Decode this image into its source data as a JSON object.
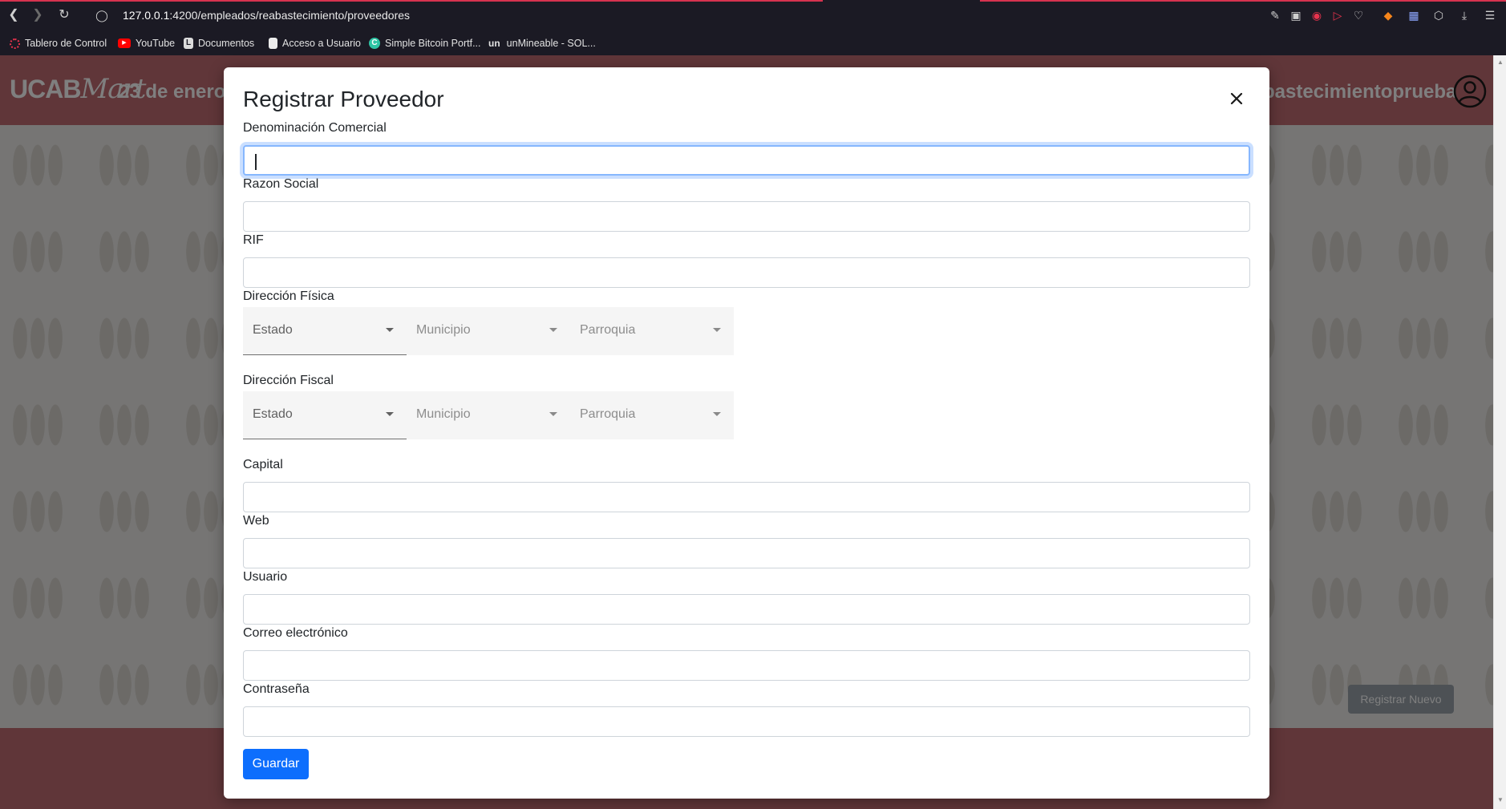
{
  "browser": {
    "url_host": "127.0.0.1",
    "url_path": ":4200/empleados/reabastecimiento/proveedores",
    "bookmarks": [
      {
        "label": "Tablero de Control",
        "icon": "dashboard-icon"
      },
      {
        "label": "YouTube",
        "icon": "youtube-icon"
      },
      {
        "label": "Documentos",
        "icon": "document-icon"
      },
      {
        "label": "Acceso a Usuario",
        "icon": "file-icon"
      },
      {
        "label": "Simple Bitcoin Portf...",
        "icon": "coin-icon"
      },
      {
        "label": "unMineable - SOL...",
        "icon": "unmineable-icon",
        "prefix": "un"
      }
    ]
  },
  "app": {
    "brand_ucab": "UCAB",
    "brand_mart": "Mart",
    "date": "23 de enero",
    "user_fragment": "bastecimientoprueba",
    "register_new_label": "Registrar Nuevo"
  },
  "modal": {
    "title": "Registrar Proveedor",
    "fields": {
      "denominacion": {
        "label": "Denominación Comercial",
        "value": ""
      },
      "razon_social": {
        "label": "Razon Social",
        "value": ""
      },
      "rif": {
        "label": "RIF",
        "value": ""
      },
      "capital": {
        "label": "Capital",
        "value": ""
      },
      "web": {
        "label": "Web",
        "value": ""
      },
      "usuario": {
        "label": "Usuario",
        "value": ""
      },
      "correo": {
        "label": "Correo electrónico",
        "value": ""
      },
      "contrasena": {
        "label": "Contraseña",
        "value": ""
      }
    },
    "direccion_fisica": {
      "label": "Dirección Física",
      "estado": "Estado",
      "municipio": "Municipio",
      "parroquia": "Parroquia"
    },
    "direccion_fiscal": {
      "label": "Dirección Fiscal",
      "estado": "Estado",
      "municipio": "Municipio",
      "parroquia": "Parroquia"
    },
    "save_label": "Guardar"
  },
  "colors": {
    "accent": "#0d6efd",
    "header": "#c16c72",
    "browser_bar": "#1b1a24"
  }
}
